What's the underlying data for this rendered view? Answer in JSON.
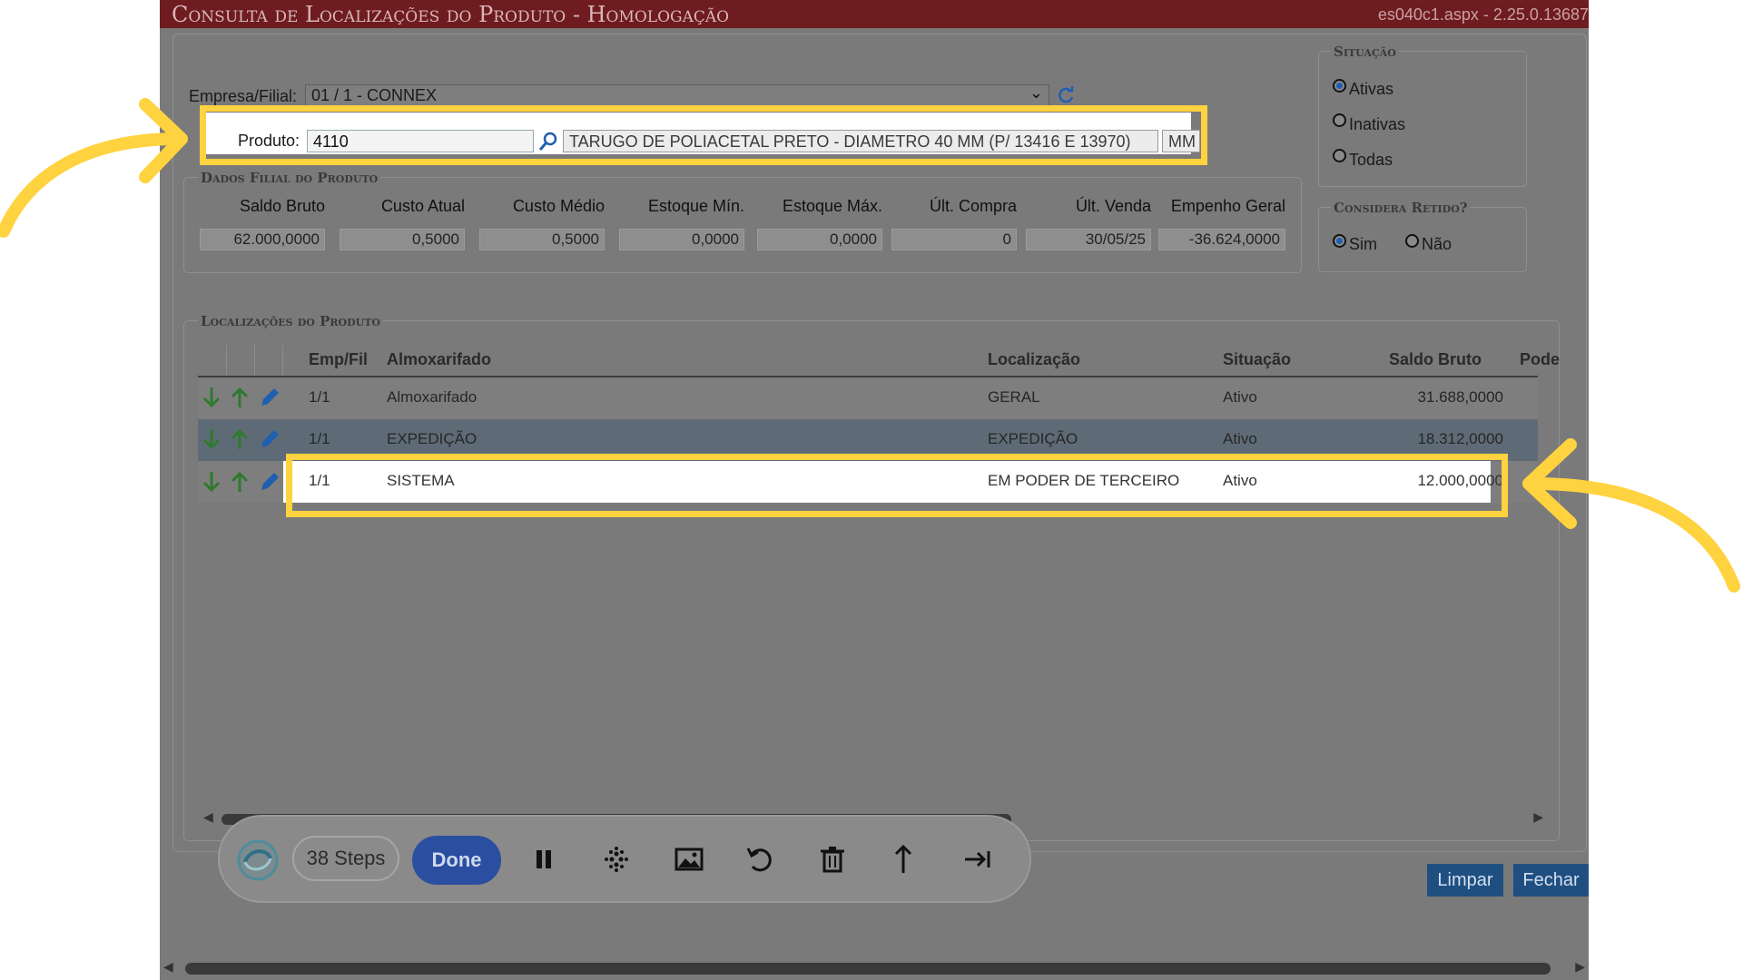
{
  "window": {
    "title": "Consulta de Localizações do Produto  - Homologação",
    "version": "es040c1.aspx - 2.25.0.13687"
  },
  "filter": {
    "empresa_label": "Empresa/Filial:",
    "empresa_value": "01 / 1 - CONNEX",
    "produto_label": "Produto:",
    "produto_value": "4110",
    "produto_desc": "TARUGO DE POLIACETAL PRETO - DIAMETRO 40 MM (P/ 13416 E 13970)",
    "unit": "MM"
  },
  "situacao": {
    "legend": "Situação",
    "options": [
      "Ativas",
      "Inativas",
      "Todas"
    ],
    "selected": "Ativas"
  },
  "retido": {
    "legend": "Considera Retido?",
    "options": [
      "Sim",
      "Não"
    ],
    "selected": "Sim"
  },
  "dados_filial": {
    "legend": "Dados Filial do Produto",
    "headers": [
      "Saldo Bruto",
      "Custo Atual",
      "Custo Médio",
      "Estoque Mín.",
      "Estoque Máx.",
      "Últ. Compra",
      "Últ. Venda",
      "Empenho Geral"
    ],
    "values": [
      "62.000,0000",
      "0,5000",
      "0,5000",
      "0,0000",
      "0,0000",
      "0",
      "30/05/25",
      "-36.624,0000"
    ]
  },
  "localizacoes": {
    "legend": "Localizações do Produto",
    "columns": [
      "Emp/Fil",
      "Almoxarifado",
      "Localização",
      "Situação",
      "Saldo Bruto",
      "Pode"
    ],
    "rows": [
      {
        "empfil": "1/1",
        "almox": "Almoxarifado",
        "local": "GERAL",
        "situacao": "Ativo",
        "saldo": "31.688,0000"
      },
      {
        "empfil": "1/1",
        "almox": "EXPEDIÇÃO",
        "local": "EXPEDIÇÃO",
        "situacao": "Ativo",
        "saldo": "18.312,0000"
      },
      {
        "empfil": "1/1",
        "almox": "SISTEMA",
        "local": "EM PODER DE TERCEIRO",
        "situacao": "Ativo",
        "saldo": "12.000,0000"
      }
    ]
  },
  "buttons": {
    "limpar": "Limpar",
    "fechar": "Fechar"
  },
  "recorder": {
    "steps": "38 Steps",
    "done": "Done"
  },
  "colors": {
    "title_bar": "#6e1c1f",
    "highlight": "#ffd23f",
    "done_button": "#2a4ea0",
    "grid_icon_green": "#2e7a2e",
    "pencil_blue": "#1f5fb0"
  },
  "icons": [
    "refresh-icon",
    "search-icon",
    "arrow-down-icon",
    "arrow-up-icon",
    "pencil-icon",
    "pause-icon",
    "blur-icon",
    "image-icon",
    "undo-icon",
    "trash-icon",
    "share-icon",
    "skip-end-icon"
  ]
}
